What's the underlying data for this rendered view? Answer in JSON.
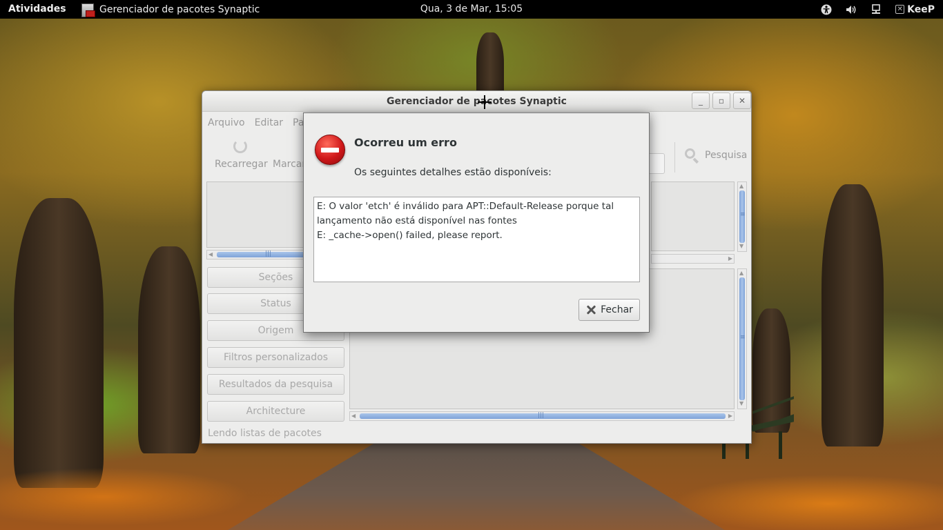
{
  "topbar": {
    "activities": "Atividades",
    "app_menu_title": "Gerenciador de pacotes Synaptic",
    "clock": "Qua,  3 de Mar, 15:05",
    "tray_user": "KeeP"
  },
  "window": {
    "title": "Gerenciador de pacotes Synaptic",
    "menu": [
      "Arquivo",
      "Editar",
      "Paco"
    ],
    "toolbar": {
      "reload_label": "Recarregar",
      "mark_label": "Marcar",
      "search_label": "Pesquisa"
    },
    "filters": [
      "Seções",
      "Status",
      "Origem",
      "Filtros personalizados",
      "Resultados da pesquisa",
      "Architecture"
    ],
    "status_text": "Lendo listas de pacotes"
  },
  "dialog": {
    "title": "Ocorreu um erro",
    "subtitle": "Os seguintes detalhes estão disponíveis:",
    "details": "E: O valor 'etch' é inválido para APT::Default-Release porque tal\nlançamento não está disponível nas fontes\nE: _cache->open() failed, please report.",
    "close_label": "Fechar"
  },
  "colors": {
    "topbar_bg": "#000000",
    "window_bg": "#ededec",
    "error_red": "#d0181a",
    "scroll_blue": "#7fa3d8"
  },
  "icons": {
    "error": "dialog-error-icon",
    "close": "close-icon",
    "search": "search-icon",
    "reload": "reload-icon"
  }
}
